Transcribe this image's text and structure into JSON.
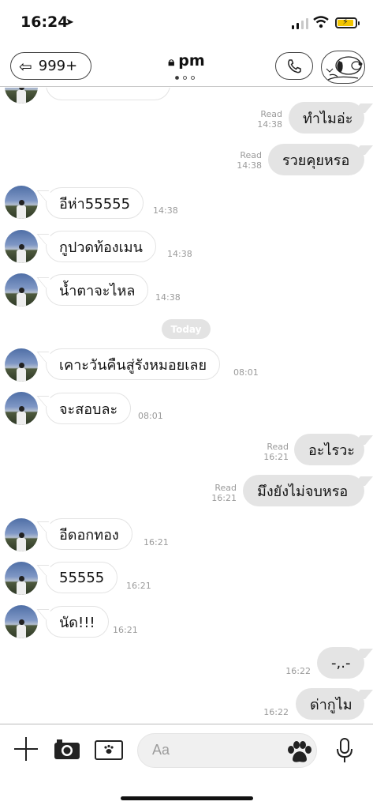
{
  "status_bar": {
    "time": "16:24",
    "battery_color": "#f2c500"
  },
  "header": {
    "back_label": "999+",
    "room_title": "pm",
    "icons": {
      "back": "arrow-left-icon",
      "lock": "lock-icon",
      "call": "phone-icon",
      "sticker": "snoopy-sticker"
    }
  },
  "messages": [
    {
      "side": "out",
      "text": "ทำไมอ่ะ",
      "read": "Read",
      "time": "14:38"
    },
    {
      "side": "out",
      "text": "รวยคุยหรอ",
      "read": "Read",
      "time": "14:38"
    },
    {
      "side": "in",
      "text": "อีห่า55555",
      "time": "14:38"
    },
    {
      "side": "in",
      "text": "กูปวดท้องเมน",
      "time": "14:38"
    },
    {
      "side": "in",
      "text": "น้ำตาจะไหล",
      "time": "14:38"
    },
    {
      "side": "in",
      "text": "เคาะวันคืนสู่รังหมอยเลย",
      "time": "08:01"
    },
    {
      "side": "in",
      "text": "จะสอบละ",
      "time": "08:01"
    },
    {
      "side": "out",
      "text": "อะไรวะ",
      "read": "Read",
      "time": "16:21"
    },
    {
      "side": "out",
      "text": "มึงยังไม่จบหรอ",
      "read": "Read",
      "time": "16:21"
    },
    {
      "side": "in",
      "text": "อีดอกทอง",
      "time": "16:21"
    },
    {
      "side": "in",
      "text": "55555",
      "time": "16:21"
    },
    {
      "side": "in",
      "text": "นัด!!!",
      "time": "16:21"
    },
    {
      "side": "out",
      "text": "-,.-",
      "time": "16:22"
    },
    {
      "side": "out",
      "text": "ด่ากูไม",
      "time": "16:22"
    }
  ],
  "date_divider": "Today",
  "input": {
    "placeholder": "Aa"
  },
  "colors": {
    "outgoing_bubble": "#e4e4e4",
    "incoming_bubble": "#ffffff",
    "meta_text": "#9a9a9a"
  }
}
